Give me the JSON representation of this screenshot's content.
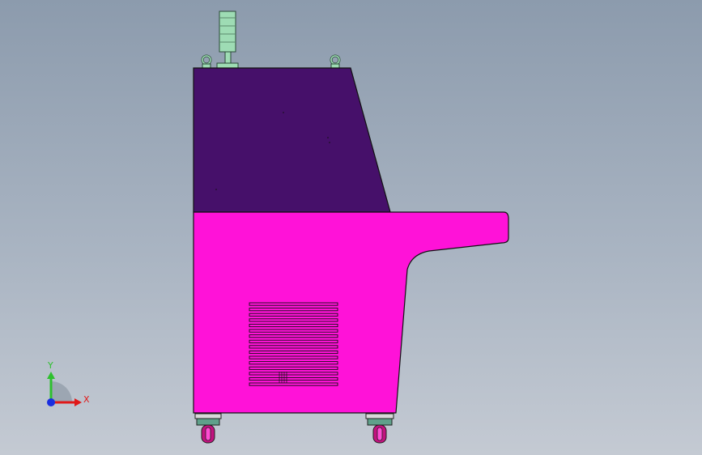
{
  "triad": {
    "x_label": "X",
    "y_label": "Y",
    "x_color": "#e01818",
    "y_color": "#2ec02e",
    "origin_color": "#1a2ee0"
  },
  "model": {
    "upper_housing_color": "#46106a",
    "lower_body_color": "#ff12d8",
    "vent_color": "#ff12d8",
    "stack_light_color": "#9edcb4",
    "caster_wheel_color": "#c2127f",
    "lifting_eye_color": "#9edcb4"
  }
}
